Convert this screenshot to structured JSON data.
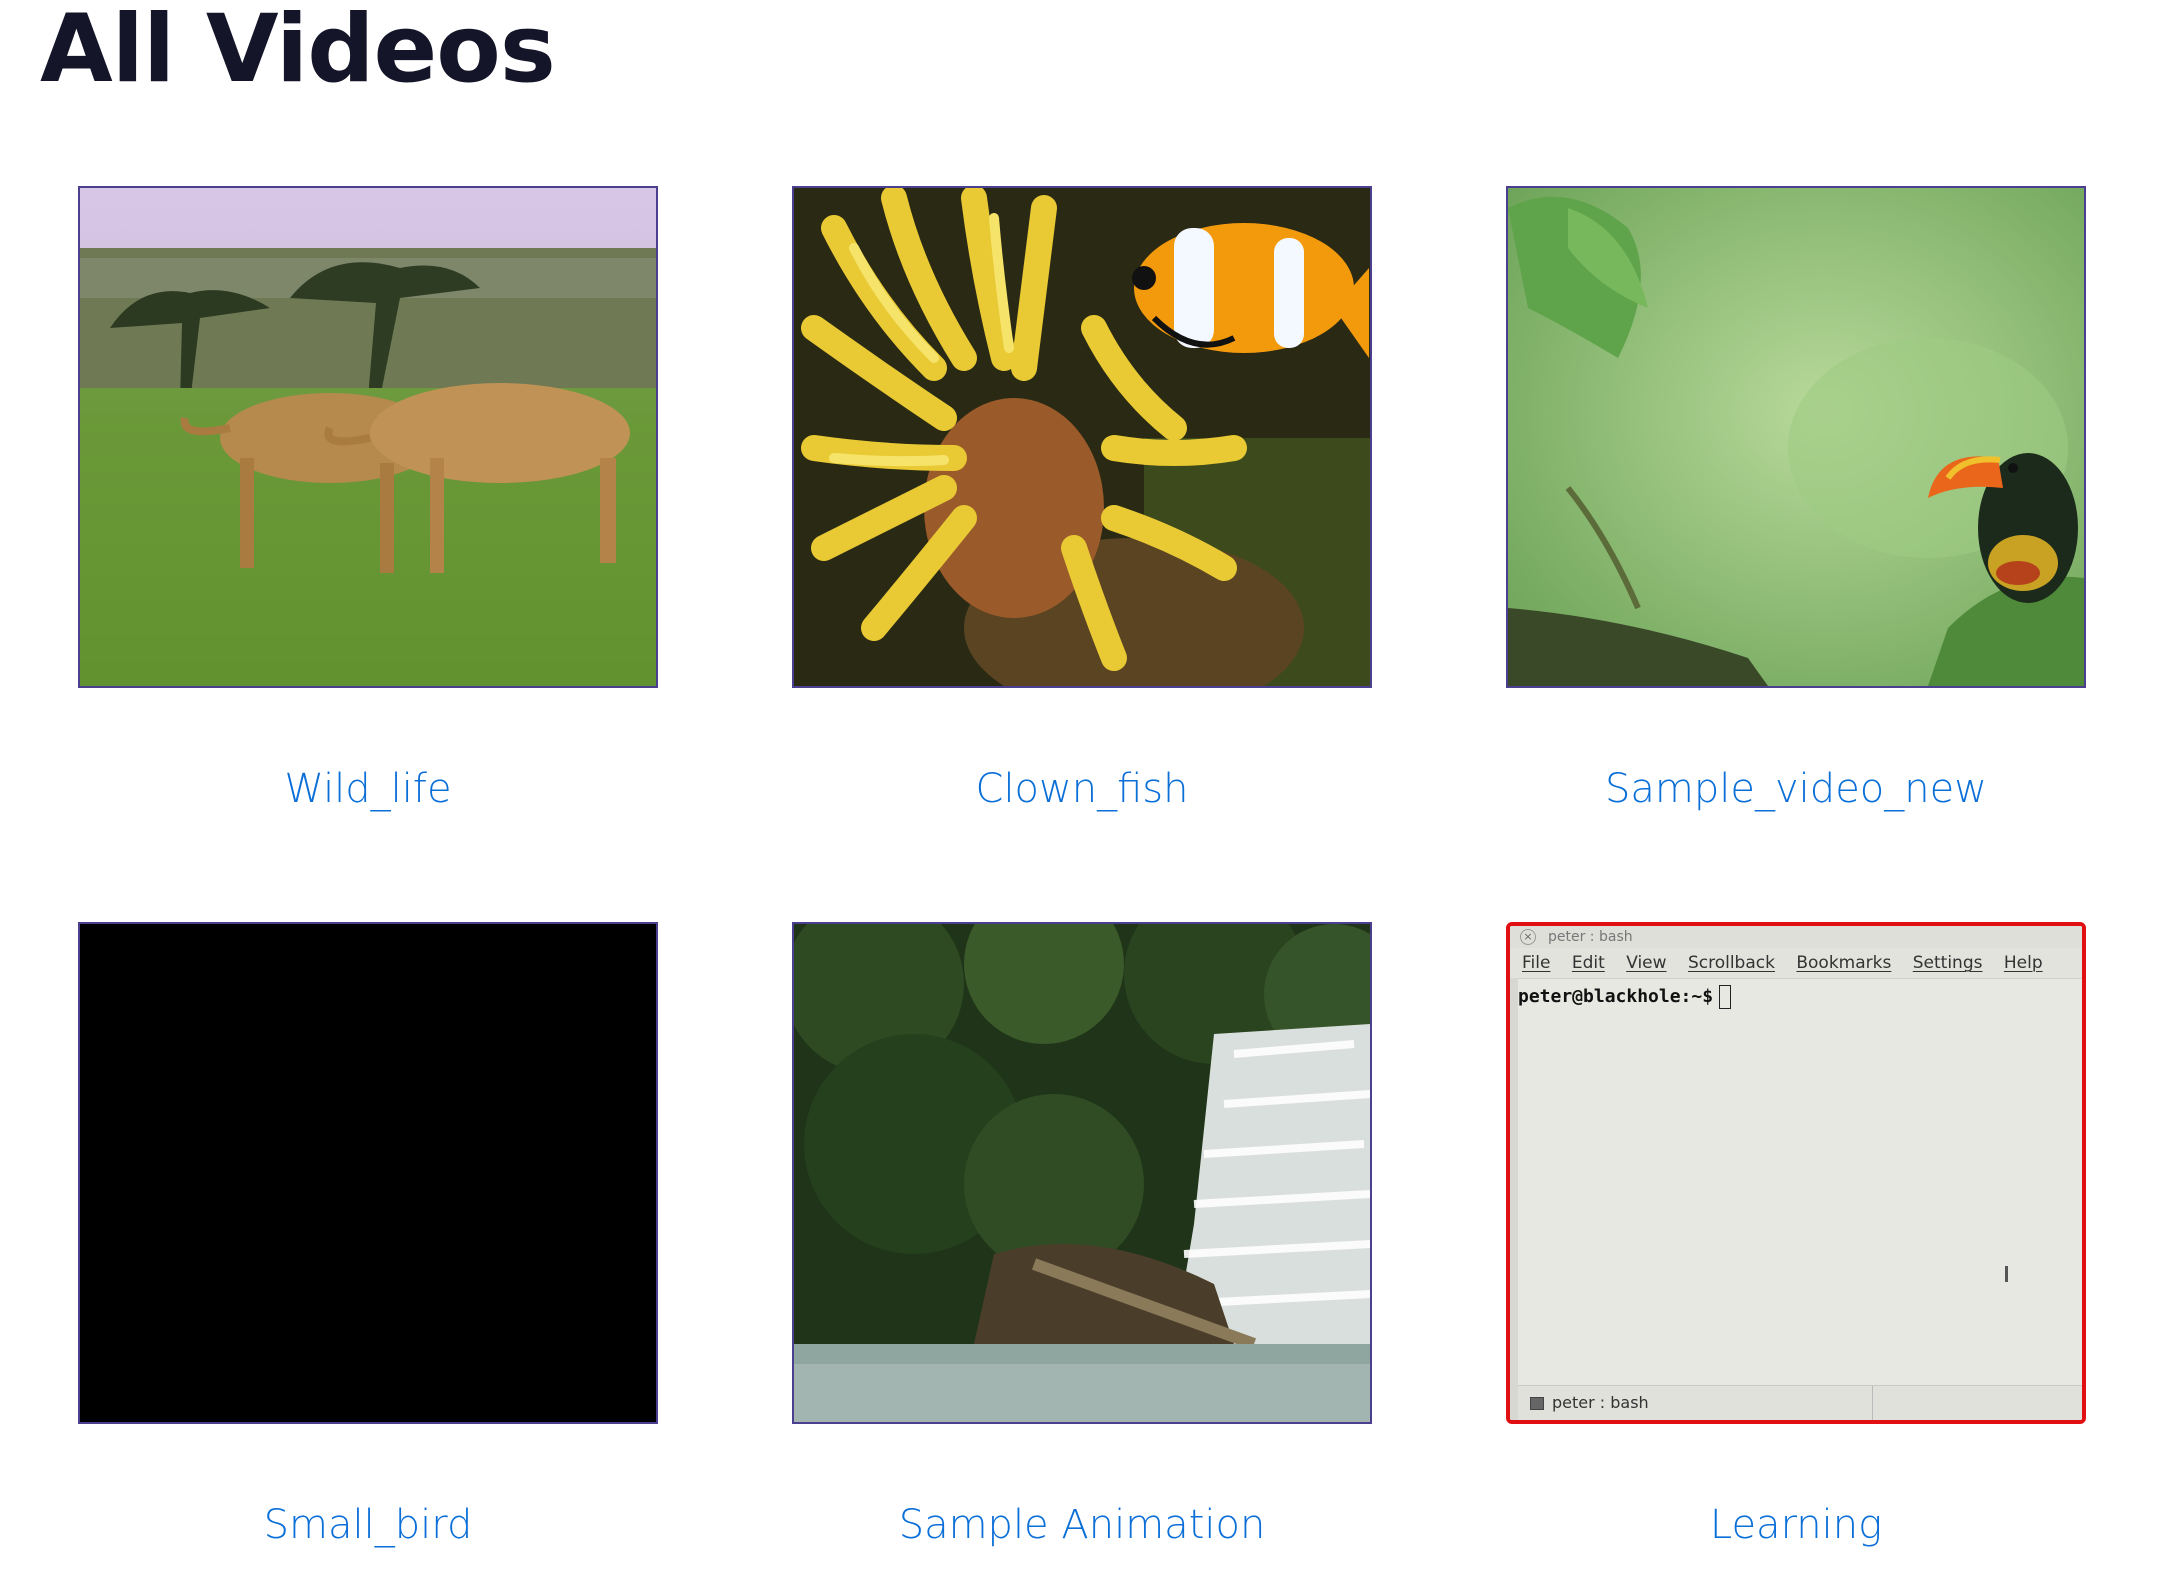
{
  "page": {
    "title": "All Videos"
  },
  "videos": [
    {
      "title": "Wild_life",
      "thumbnail": "lions-walking-savanna"
    },
    {
      "title": "Clown_fish",
      "thumbnail": "clownfish-anemone"
    },
    {
      "title": "Sample_video_new",
      "thumbnail": "toucan-on-branch"
    },
    {
      "title": "Small_bird",
      "thumbnail": "black-frame"
    },
    {
      "title": "Sample Animation",
      "thumbnail": "forest-waterfall"
    },
    {
      "title": "Learning",
      "thumbnail": "terminal-window",
      "selected": true
    }
  ],
  "terminal": {
    "window_title": "peter : bash",
    "menu": [
      "File",
      "Edit",
      "View",
      "Scrollback",
      "Bookmarks",
      "Settings",
      "Help"
    ],
    "prompt": "peter@blackhole:~$",
    "tab_label": "peter : bash"
  },
  "colors": {
    "link": "#0b6fd8",
    "heading": "#15152a",
    "selection": "#e10e12",
    "thumb_border": "#4b3f8f"
  }
}
